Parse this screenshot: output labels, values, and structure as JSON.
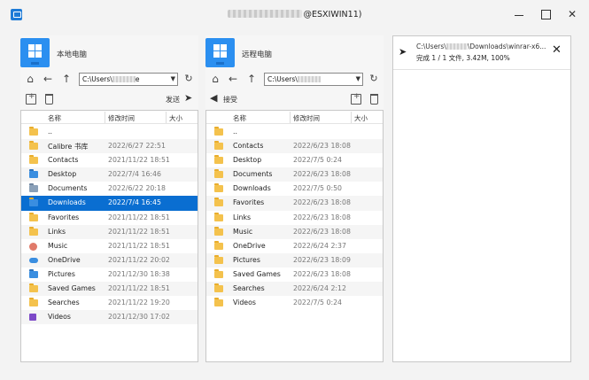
{
  "window": {
    "title_suffix": "@ESXIWIN11)"
  },
  "local": {
    "title": "本地电脑",
    "path_prefix": "C:\\Users\\",
    "path_suffix": "e",
    "send_label": "发送",
    "columns": {
      "name": "名称",
      "time": "修改时间",
      "size": "大小"
    },
    "files": [
      {
        "name": "..",
        "time": "",
        "icon": "folder"
      },
      {
        "name": "Calibre 书库",
        "time": "2022/6/27 22:51",
        "icon": "folder"
      },
      {
        "name": "Contacts",
        "time": "2021/11/22 18:51",
        "icon": "folder"
      },
      {
        "name": "Desktop",
        "time": "2022/7/4 16:46",
        "icon": "desktop"
      },
      {
        "name": "Documents",
        "time": "2022/6/22 20:18",
        "icon": "documents"
      },
      {
        "name": "Downloads",
        "time": "2022/7/4 16:45",
        "icon": "downloads"
      },
      {
        "name": "Favorites",
        "time": "2021/11/22 18:51",
        "icon": "folder"
      },
      {
        "name": "Links",
        "time": "2021/11/22 18:51",
        "icon": "folder"
      },
      {
        "name": "Music",
        "time": "2021/11/22 18:51",
        "icon": "music"
      },
      {
        "name": "OneDrive",
        "time": "2021/11/22 20:02",
        "icon": "onedrive"
      },
      {
        "name": "Pictures",
        "time": "2021/12/30 18:38",
        "icon": "pictures"
      },
      {
        "name": "Saved Games",
        "time": "2021/11/22 18:51",
        "icon": "folder"
      },
      {
        "name": "Searches",
        "time": "2021/11/22 19:20",
        "icon": "folder"
      },
      {
        "name": "Videos",
        "time": "2021/12/30 17:02",
        "icon": "videos"
      }
    ],
    "selected_index": 5
  },
  "remote": {
    "title": "远程电脑",
    "path_prefix": "C:\\Users\\",
    "receive_label": "接受",
    "columns": {
      "name": "名称",
      "time": "修改时间",
      "size": "大小"
    },
    "files": [
      {
        "name": "..",
        "time": ""
      },
      {
        "name": "Contacts",
        "time": "2022/6/23 18:08"
      },
      {
        "name": "Desktop",
        "time": "2022/7/5 0:24"
      },
      {
        "name": "Documents",
        "time": "2022/6/23 18:08"
      },
      {
        "name": "Downloads",
        "time": "2022/7/5 0:50"
      },
      {
        "name": "Favorites",
        "time": "2022/6/23 18:08"
      },
      {
        "name": "Links",
        "time": "2022/6/23 18:08"
      },
      {
        "name": "Music",
        "time": "2022/6/23 18:08"
      },
      {
        "name": "OneDrive",
        "time": "2022/6/24 2:37"
      },
      {
        "name": "Pictures",
        "time": "2022/6/23 18:09"
      },
      {
        "name": "Saved Games",
        "time": "2022/6/23 18:08"
      },
      {
        "name": "Searches",
        "time": "2022/6/24 2:12"
      },
      {
        "name": "Videos",
        "time": "2022/7/5 0:24"
      }
    ]
  },
  "transfer": {
    "path_prefix": "C:\\Users\\",
    "path_suffix": "\\Downloads\\winrar-x6...",
    "status": "完成 1 / 1 文件, 3.42M, 100%"
  },
  "colors": {
    "accent": "#0a6ed1",
    "folder": "#f4c24d"
  }
}
